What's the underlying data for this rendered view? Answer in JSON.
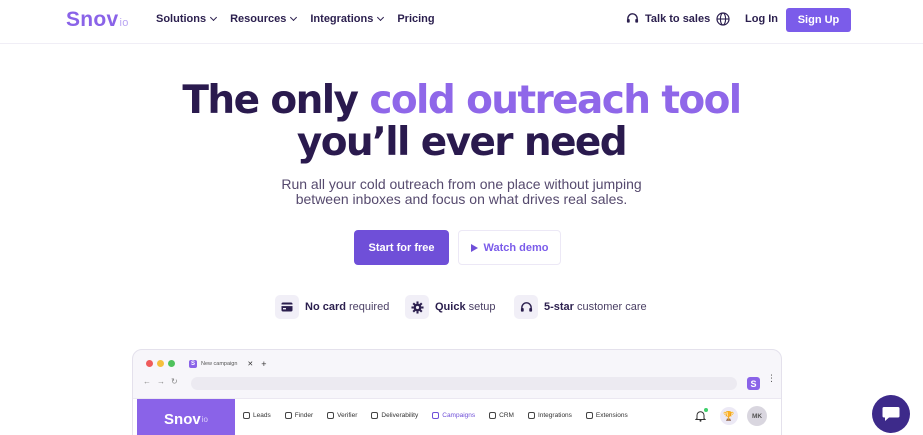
{
  "nav": {
    "logo": "Snov",
    "logo_suffix": "io",
    "links": [
      {
        "label": "Solutions",
        "dropdown": true
      },
      {
        "label": "Resources",
        "dropdown": true
      },
      {
        "label": "Integrations",
        "dropdown": true
      },
      {
        "label": "Pricing",
        "dropdown": false
      }
    ],
    "talk_to_sales": "Talk to sales",
    "login": "Log In",
    "signup": "Sign Up"
  },
  "hero": {
    "title_part1": "The only ",
    "title_accent": "cold outreach tool",
    "title_line2": "you’ll ever need",
    "subtitle_line1": "Run all your cold outreach from one place without jumping",
    "subtitle_line2": "between inboxes and focus on what drives real sales.",
    "cta_primary": "Start for free",
    "cta_secondary": "Watch demo"
  },
  "features": [
    {
      "bold": "No card",
      "rest": "required",
      "icon": "card-icon"
    },
    {
      "bold": "Quick",
      "rest": "setup",
      "icon": "gear-icon"
    },
    {
      "bold": "5-star",
      "rest": "customer care",
      "icon": "headset-icon"
    }
  ],
  "browser": {
    "tab_title": "New campaign",
    "app_logo": "Snov",
    "app_logo_suffix": "io",
    "menu": [
      {
        "label": "Leads"
      },
      {
        "label": "Finder"
      },
      {
        "label": "Verifier"
      },
      {
        "label": "Deliverability"
      },
      {
        "label": "Campaigns",
        "active": true
      },
      {
        "label": "CRM"
      },
      {
        "label": "Integrations"
      },
      {
        "label": "Extensions"
      }
    ],
    "avatar_initials": "MK"
  },
  "colors": {
    "brand": "#7b5cea",
    "accent_text": "#8f67e9",
    "heading": "#2a1a4e"
  }
}
